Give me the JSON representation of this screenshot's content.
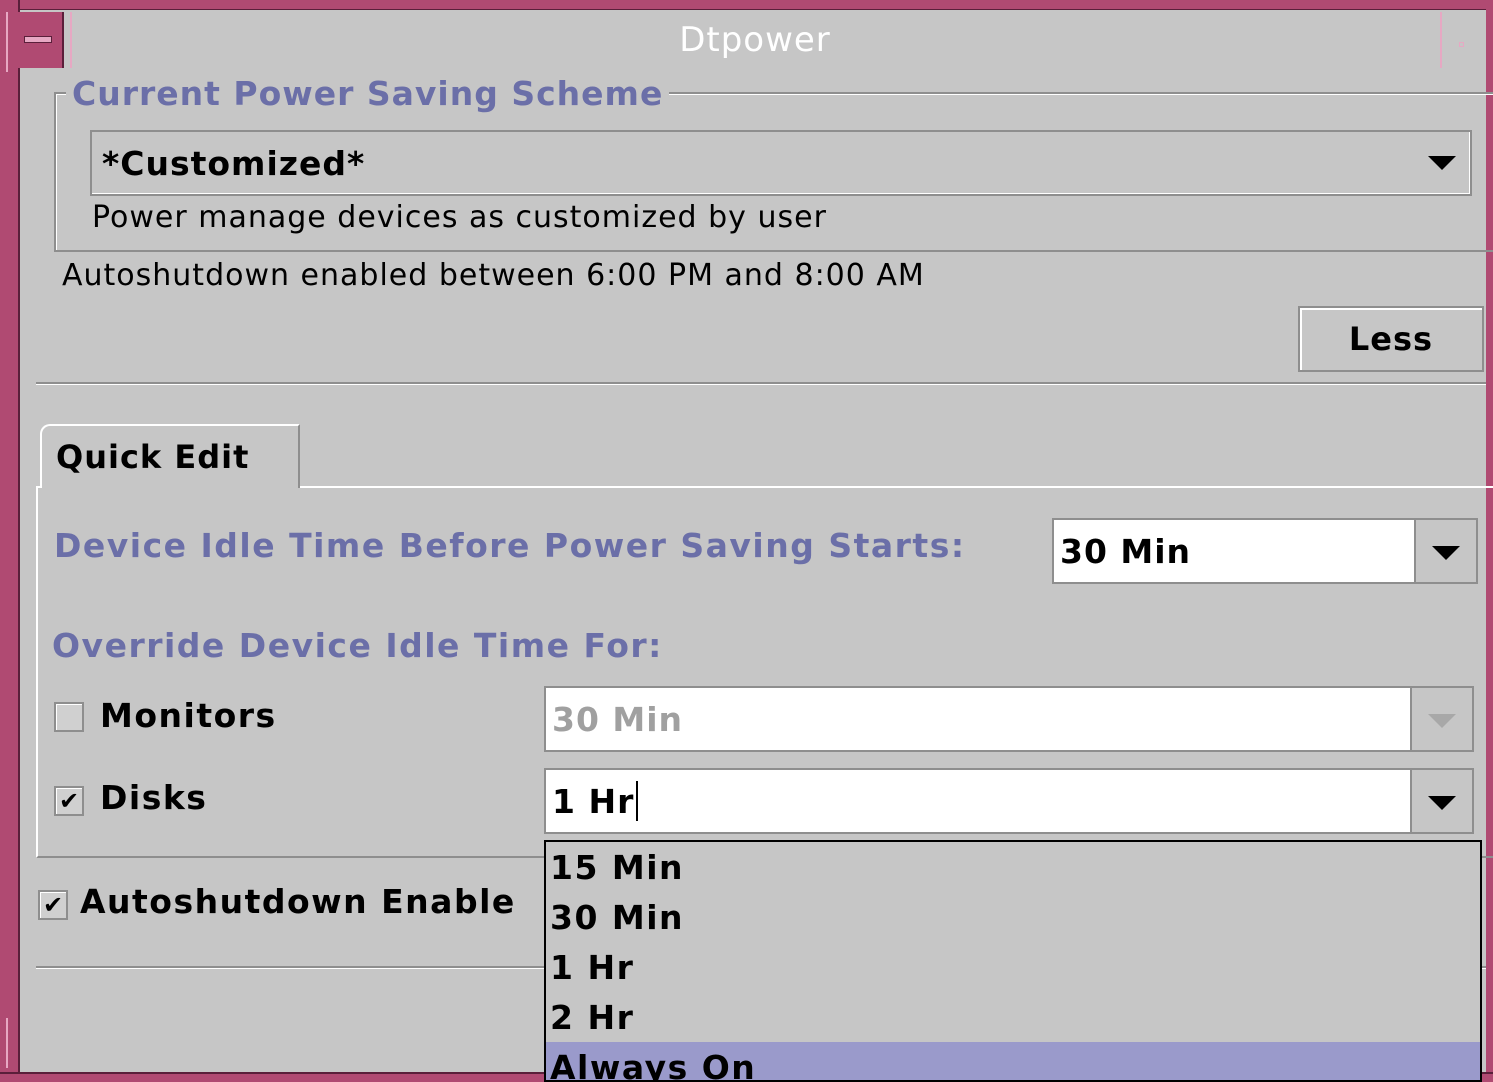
{
  "window": {
    "title": "Dtpower"
  },
  "scheme": {
    "group_title": "Current Power Saving Scheme",
    "selected": "*Customized*",
    "description": "Power manage devices as customized by user"
  },
  "autoshutdown_info": "Autoshutdown enabled between 6:00 PM and 8:00 AM",
  "less_button": "Less",
  "tabs": [
    {
      "label": "Quick Edit"
    }
  ],
  "quick_edit": {
    "idle_label": "Device Idle Time Before Power Saving Starts:",
    "idle_value": "30 Min",
    "override_label": "Override Device Idle Time For:",
    "monitors": {
      "label": "Monitors",
      "checked": false,
      "value": "30 Min",
      "enabled": false
    },
    "disks": {
      "label": "Disks",
      "checked": true,
      "value": "1 Hr",
      "enabled": true
    }
  },
  "autoshutdown": {
    "label": "Autoshutdown Enable",
    "checked": true
  },
  "disks_dropdown": {
    "options": [
      "15 Min",
      "30 Min",
      "1 Hr",
      "2 Hr",
      "Always On"
    ],
    "highlighted": "Always On"
  },
  "colors": {
    "title_bar": "#b04a72",
    "label_blue": "#6b6fa8",
    "highlight": "#9a9acb",
    "background": "#c6c6c6"
  }
}
